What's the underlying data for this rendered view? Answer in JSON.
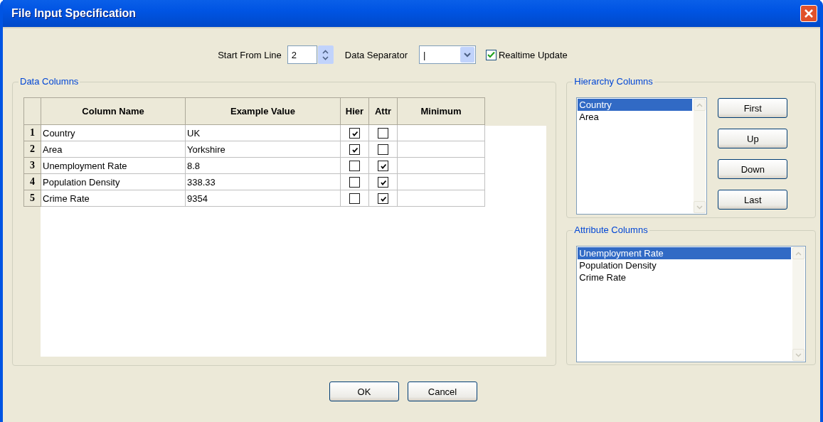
{
  "window": {
    "title": "File Input Specification"
  },
  "options": {
    "start_line_label": "Start From Line",
    "start_line": "2",
    "separator_label": "Data Separator",
    "separator": "|",
    "realtime_label": "Realtime Update",
    "realtime_checked": true
  },
  "data_columns": {
    "title": "Data Columns",
    "columns": [
      "Column Name",
      "Example Value",
      "Hier",
      "Attr",
      "Minimum"
    ],
    "rows": [
      {
        "number": "1",
        "name": "Country",
        "example": "UK",
        "hier": true,
        "attr": false
      },
      {
        "number": "2",
        "name": "Area",
        "example": "Yorkshire",
        "hier": true,
        "attr": false
      },
      {
        "number": "3",
        "name": "Unemployment Rate",
        "example": "8.8",
        "hier": false,
        "attr": true
      },
      {
        "number": "4",
        "name": "Population Density",
        "example": "338.33",
        "hier": false,
        "attr": true
      },
      {
        "number": "5",
        "name": "Crime Rate",
        "example": "9354",
        "hier": false,
        "attr": true
      }
    ]
  },
  "hierarchy_columns": {
    "title": "Hierarchy Columns",
    "items": [
      {
        "label": "Country",
        "selected": true
      },
      {
        "label": "Area",
        "selected": false
      }
    ],
    "buttons": [
      "First",
      "Up",
      "Down",
      "Last"
    ]
  },
  "attribute_columns": {
    "title": "Attribute Columns",
    "items": [
      {
        "label": "Unemployment Rate",
        "selected": true
      },
      {
        "label": "Population Density",
        "selected": false
      },
      {
        "label": "Crime Rate",
        "selected": false
      }
    ]
  },
  "buttons": [
    "OK",
    "Cancel"
  ]
}
